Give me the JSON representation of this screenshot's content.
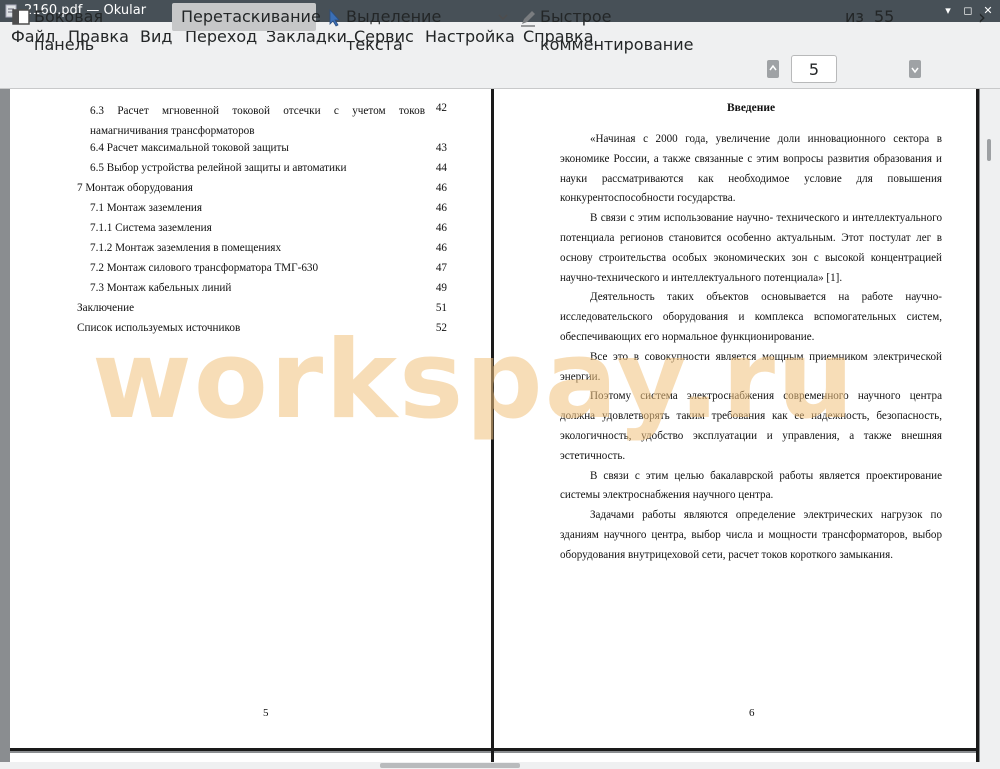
{
  "window": {
    "title": "2160.pdf  — Okular",
    "buttons": {
      "minimize": "▾",
      "maximize": "◻",
      "close": "✕"
    }
  },
  "menu": [
    "Файл",
    "Правка",
    "Вид",
    "Переход",
    "Закладки",
    "Сервис",
    "Настройка",
    "Справка"
  ],
  "toolbar": {
    "sidebar_label": "Боковая панель",
    "drag_label": "Перетаскивание",
    "text_select_label": "Выделение текста",
    "quick_annotate_label": "Быстрое комментирование",
    "page_current": "5",
    "page_of_label": "из",
    "page_total": "55",
    "overflow_icon": "›"
  },
  "left_page": {
    "page_number": "5",
    "toc": [
      {
        "text": "6.3 Расчет мгновенной токовой отсечки с учетом токов намагничивания трансформаторов",
        "page": "42"
      },
      {
        "text": "6.4 Расчет максимальной токовой защиты",
        "page": "43"
      },
      {
        "text": "6.5 Выбор устройства релейной защиты и автоматики",
        "page": "44"
      },
      {
        "text": "7 Монтаж оборудования",
        "page": "46"
      },
      {
        "text": "7.1 Монтаж заземления",
        "page": "46"
      },
      {
        "text": "7.1.1 Система заземления",
        "page": "46"
      },
      {
        "text": "7.1.2 Монтаж заземления в помещениях",
        "page": "46"
      },
      {
        "text": "7.2 Монтаж силового трансформатора ТМГ-630",
        "page": "47"
      },
      {
        "text": "7.3 Монтаж кабельных линий",
        "page": "49"
      },
      {
        "text": "Заключение",
        "page": "51"
      },
      {
        "text": "Список используемых источников",
        "page": "52"
      }
    ]
  },
  "right_page": {
    "page_number": "6",
    "heading": "Введение",
    "paragraphs": [
      "«Начиная с 2000 года, увеличение доли инновационного сектора в экономике России, а также связанные с этим вопросы развития образования и науки рассматриваются как необходимое условие для повышения конкурентоспособности государства.",
      "В связи с этим использование научно- технического и интеллектуального потенциала регионов становится особенно актуальным. Этот постулат лег в основу строительства особых экономических зон с высокой концентрацией научно-технического и интеллектуального потенциала» [1].",
      "Деятельность таких объектов основывается на работе научно-исследовательского оборудования и комплекса вспомогательных систем, обеспечивающих его нормальное функционирование.",
      "Все это в совокупности является мощным приемником электрической энергии.",
      "Поэтому система электроснабжения современного научного центра должна удовлетворять таким требования как ее надежность, безопасность, экологичность, удобство эксплуатации и управления, а также внешняя эстетичность.",
      "В связи с этим целью бакалаврской работы является проектирование системы электроснабжения научного центра.",
      "Задачами работы являются определение электрических нагрузок по зданиям научного центра, выбор числа и мощности трансформаторов, выбор оборудования внутрицеховой сети, расчет токов короткого замыкания."
    ]
  },
  "watermark": "workspay.ru"
}
